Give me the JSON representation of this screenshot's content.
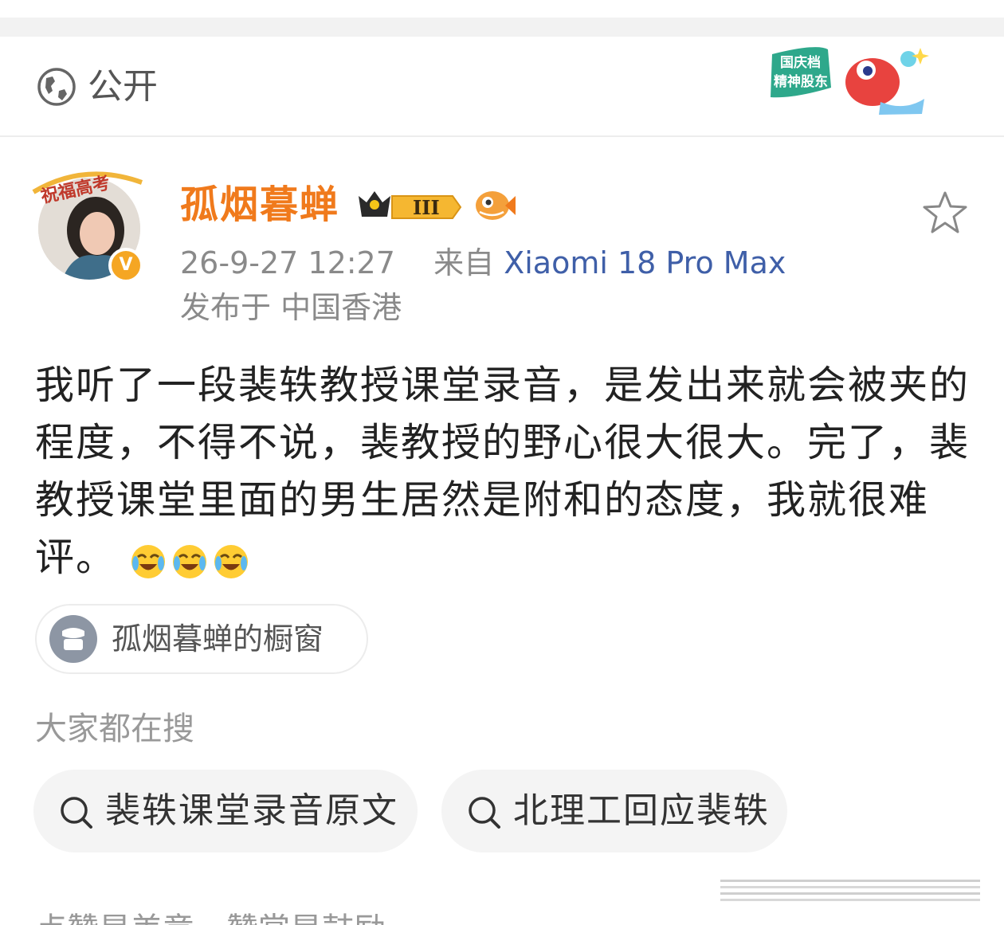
{
  "visibility": {
    "label": "公开",
    "icon": "globe-icon"
  },
  "promo": {
    "line1": "国庆档",
    "line2": "精神股东"
  },
  "author": {
    "avatar_frame_text": "祝福高考",
    "verified_mark": "V",
    "name": "孤烟暮蝉",
    "level_badge": "III",
    "name_color": "#f07a1c"
  },
  "post": {
    "time": "26-9-27 12:27",
    "from_label": "来自",
    "source": "Xiaomi 18 Pro Max",
    "location": "发布于 中国香港",
    "text": "我听了一段裴轶教授课堂录音，是发出来就会被夹的程度，不得不说，裴教授的野心很大很大。完了，裴教授课堂里面的男生居然是附和的态度，我就很难评。",
    "emoji_count": 3,
    "source_color": "#3f5fa8"
  },
  "shop": {
    "label": "孤烟暮蝉的橱窗"
  },
  "hot_search": {
    "heading": "大家都在搜",
    "items": [
      "裴轶课堂录音原文",
      "北理工回应裴轶"
    ]
  },
  "footer_partial": {
    "text": "点赞是美意，赞赏是鼓励"
  }
}
